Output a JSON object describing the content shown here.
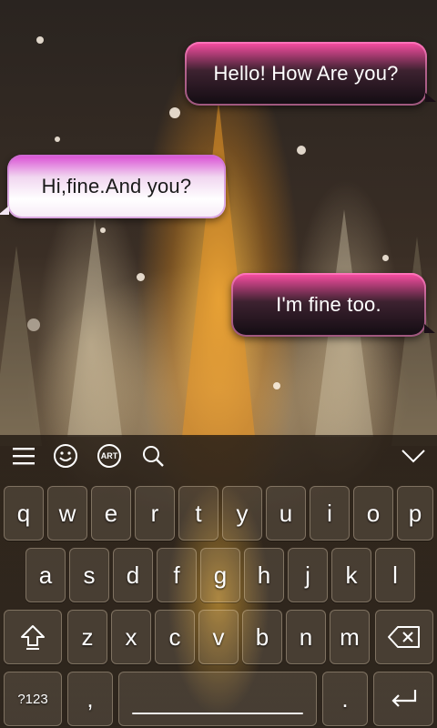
{
  "chat": {
    "messages": [
      {
        "text": "Hello! How Are you?",
        "side": "outgoing"
      },
      {
        "text": "Hi,fine.And you?",
        "side": "incoming"
      },
      {
        "text": "I'm fine too.",
        "side": "outgoing"
      }
    ]
  },
  "toolbar": {
    "icons": [
      "menu-icon",
      "emoji-icon",
      "art-icon",
      "search-icon",
      "collapse-chevron-icon"
    ],
    "art_label": "ART"
  },
  "keyboard": {
    "row1": [
      "q",
      "w",
      "e",
      "r",
      "t",
      "y",
      "u",
      "i",
      "o",
      "p"
    ],
    "row2": [
      "a",
      "s",
      "d",
      "f",
      "g",
      "h",
      "j",
      "k",
      "l"
    ],
    "row3": [
      "z",
      "x",
      "c",
      "v",
      "b",
      "n",
      "m"
    ],
    "symbols_label": "?123",
    "comma_label": ",",
    "period_label": ".",
    "shift_icon": "shift-icon",
    "backspace_icon": "backspace-icon",
    "enter_icon": "enter-icon"
  },
  "colors": {
    "outgoing_bubble": "#3d2230",
    "incoming_bubble": "#ffffff",
    "accent_pink": "#ff4fa6"
  }
}
